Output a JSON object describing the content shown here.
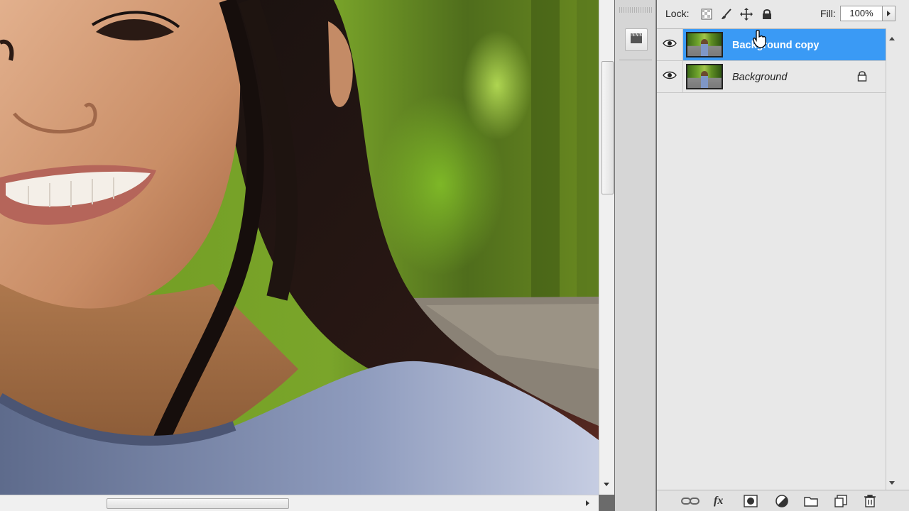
{
  "layers_panel": {
    "lock_label": "Lock:",
    "lock_icons": [
      "lock-transparent-pixels-icon",
      "lock-image-pixels-icon",
      "lock-position-icon",
      "lock-all-icon"
    ],
    "fill_label": "Fill:",
    "fill_value": "100%",
    "layers": [
      {
        "name": "Background copy",
        "selected": true,
        "visible": true
      },
      {
        "name": "Background",
        "selected": false,
        "visible": true,
        "locked": true
      }
    ],
    "bottom_icons": [
      "link-layers-icon",
      "fx-icon",
      "layer-mask-icon",
      "adjustment-layer-icon",
      "new-group-icon",
      "new-layer-icon",
      "delete-layer-icon"
    ],
    "fx_label": "fx"
  },
  "colors": {
    "selection_blue": "#3a9af5",
    "panel_bg": "#e8e8e8",
    "workspace_gray": "#6b6b6b"
  }
}
